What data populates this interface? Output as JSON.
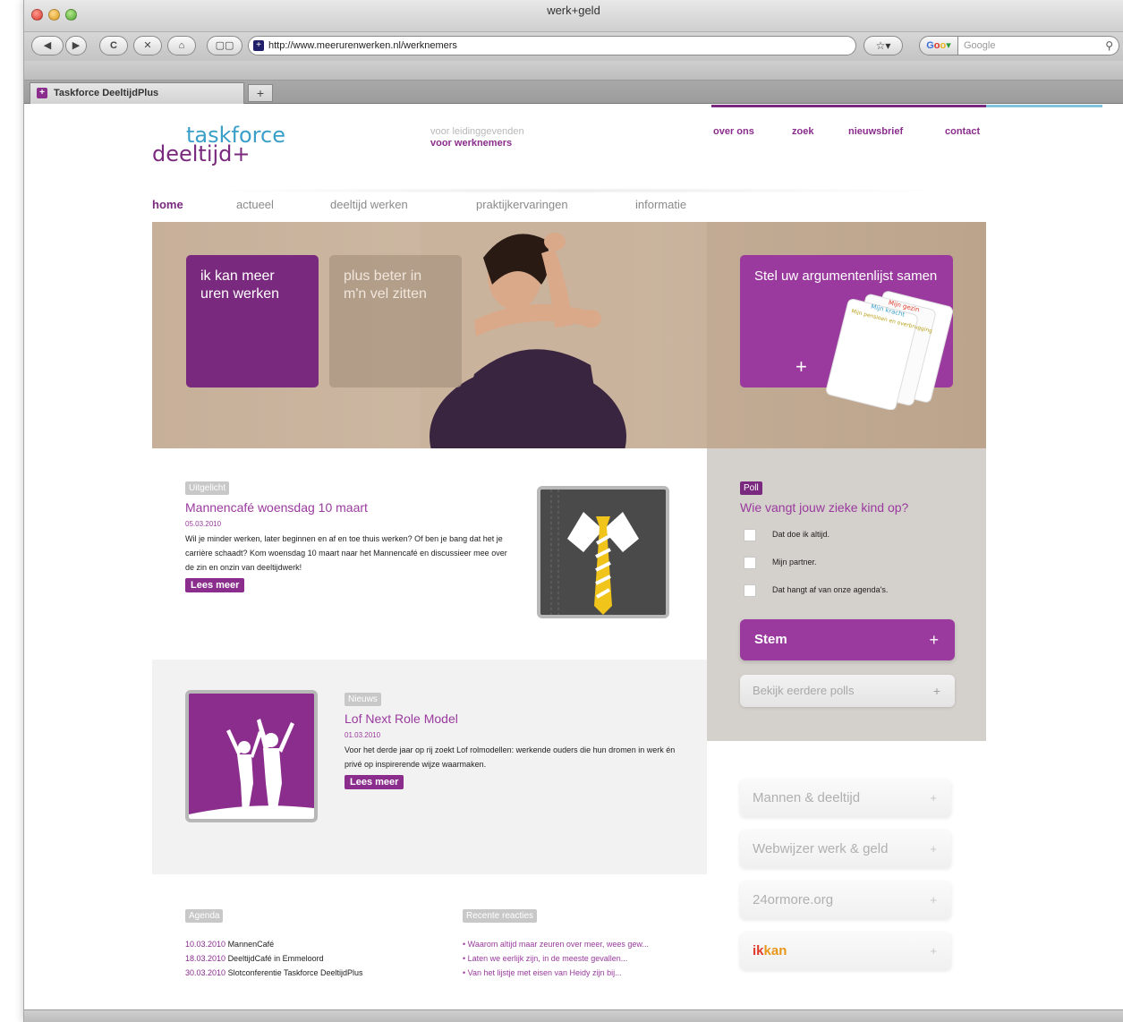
{
  "browser": {
    "window_title": "werk+geld",
    "url": "http://www.meerurenwerken.nl/werknemers",
    "search_placeholder": "Google",
    "tab_title": "Taskforce DeeltijdPlus",
    "new_tab_label": "+",
    "back_icon": "◀",
    "forward_icon": "▶",
    "reload_icon": "C",
    "stop_icon": "✕",
    "home_icon": "⌂"
  },
  "site": {
    "logo_top": "taskforce",
    "logo_bottom": "deeltijd+",
    "audience": {
      "leaders": "voor leidinggevenden",
      "employees": "voor werknemers"
    },
    "topnav": [
      "over ons",
      "zoek",
      "nieuwsbrief",
      "contact"
    ],
    "mainnav": [
      "home",
      "actueel",
      "deeltijd werken",
      "praktijkervaringen",
      "informatie"
    ],
    "hero": {
      "box1": "ik kan meer uren werken",
      "box2": "plus beter in m'n vel zitten",
      "box3": "Stel uw argumentenlijst samen",
      "box3_plus": "+"
    },
    "featured": {
      "tag": "Uitgelicht",
      "title": "Mannencafé woensdag 10 maart",
      "date": "05.03.2010",
      "body": "Wil je minder werken, later beginnen en af en toe thuis werken? Of ben je bang dat het je carrière schaadt? Kom woensdag 10 maart naar het Mannencafé en discussieer mee over de zin en onzin van deeltijdwerk!",
      "read_more": "Lees meer"
    },
    "news": {
      "tag": "Nieuws",
      "title": "Lof Next Role Model",
      "date": "01.03.2010",
      "body": "Voor het derde jaar op rij zoekt Lof rolmodellen: werkende ouders die hun dromen in werk én privé op inspirerende wijze waarmaken.",
      "read_more": "Lees meer"
    },
    "agenda": {
      "tag": "Agenda",
      "items": [
        {
          "date": "10.03.2010",
          "text": "MannenCafé"
        },
        {
          "date": "18.03.2010",
          "text": "DeeltijdCafé in Emmeloord"
        },
        {
          "date": "30.03.2010",
          "text": "Slotconferentie Taskforce DeeltijdPlus"
        }
      ]
    },
    "reacties": {
      "tag": "Recente reacties",
      "items": [
        "Waarom altijd maar zeuren over meer, wees gew...",
        "Laten we eerlijk zijn, in de meeste gevallen...",
        "Van het lijstje met eisen van Heidy zijn bij..."
      ]
    },
    "poll": {
      "tag": "Poll",
      "question": "Wie vangt jouw zieke kind op?",
      "options": [
        "Dat doe ik altijd.",
        "Mijn partner.",
        "Dat hangt af van onze agenda's."
      ],
      "vote_label": "Stem",
      "vote_plus": "+",
      "older_label": "Bekijk eerdere polls",
      "older_plus": "+"
    },
    "links": [
      {
        "label": "Mannen & deeltijd",
        "plus": "+"
      },
      {
        "label": "Webwijzer werk & geld",
        "plus": "+"
      },
      {
        "label": "24ormore.org",
        "plus": "+"
      }
    ],
    "ikkan": {
      "ik": "ik",
      "kan": "kan",
      "plus": "+"
    },
    "cards": [
      "Mijn gezin",
      "Mijn kracht",
      "Mijn pensioen en overbrugging"
    ]
  }
}
